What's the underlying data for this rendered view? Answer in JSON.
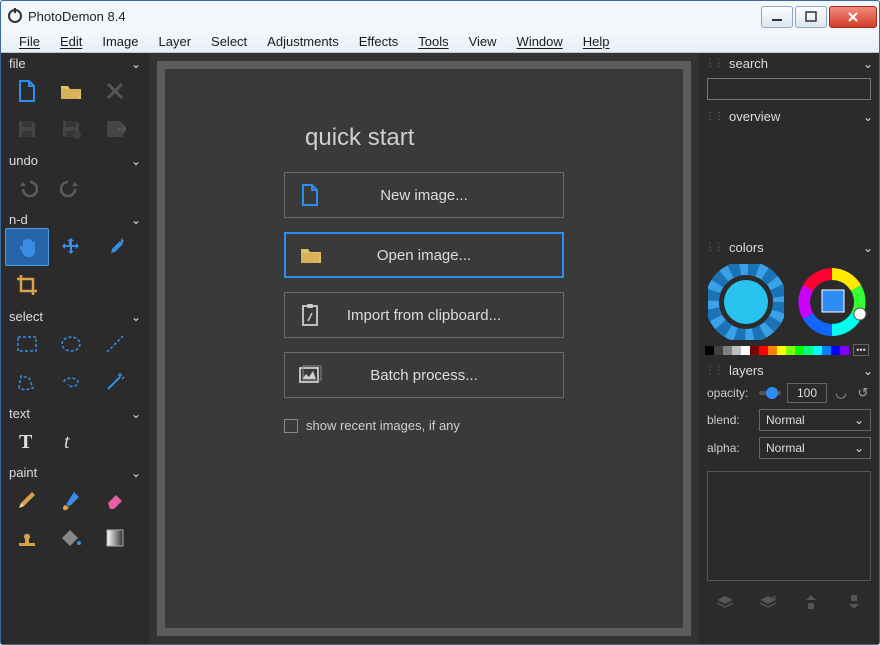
{
  "window": {
    "title": "PhotoDemon 8.4"
  },
  "menu": [
    "File",
    "Edit",
    "Image",
    "Layer",
    "Select",
    "Adjustments",
    "Effects",
    "Tools",
    "View",
    "Window",
    "Help"
  ],
  "menu_underlined": [
    "File",
    "Edit",
    "Tools",
    "Window",
    "Help"
  ],
  "left_panel": {
    "file": {
      "label": "file"
    },
    "undo": {
      "label": "undo"
    },
    "nd": {
      "label": "n-d"
    },
    "select": {
      "label": "select"
    },
    "text": {
      "label": "text"
    },
    "paint": {
      "label": "paint"
    }
  },
  "quick_start": {
    "title": "quick start",
    "buttons": [
      {
        "key": "new",
        "label": "New image..."
      },
      {
        "key": "open",
        "label": "Open image...",
        "selected": true
      },
      {
        "key": "clip",
        "label": "Import from clipboard..."
      },
      {
        "key": "batch",
        "label": "Batch process..."
      }
    ],
    "recent_checkbox": "show recent images, if any"
  },
  "right_panel": {
    "search": {
      "label": "search",
      "placeholder": ""
    },
    "overview": {
      "label": "overview"
    },
    "colors": {
      "label": "colors"
    },
    "swatches": [
      "#000000",
      "#404040",
      "#808080",
      "#c0c0c0",
      "#ffffff",
      "#800000",
      "#ff0000",
      "#ff8000",
      "#ffff00",
      "#80ff00",
      "#00ff00",
      "#00ff80",
      "#00ffff",
      "#0080ff",
      "#0000ff",
      "#8000ff"
    ],
    "layers": {
      "label": "layers",
      "opacity_label": "opacity:",
      "opacity_value": "100",
      "blend_label": "blend:",
      "blend_value": "Normal",
      "alpha_label": "alpha:",
      "alpha_value": "Normal"
    }
  }
}
